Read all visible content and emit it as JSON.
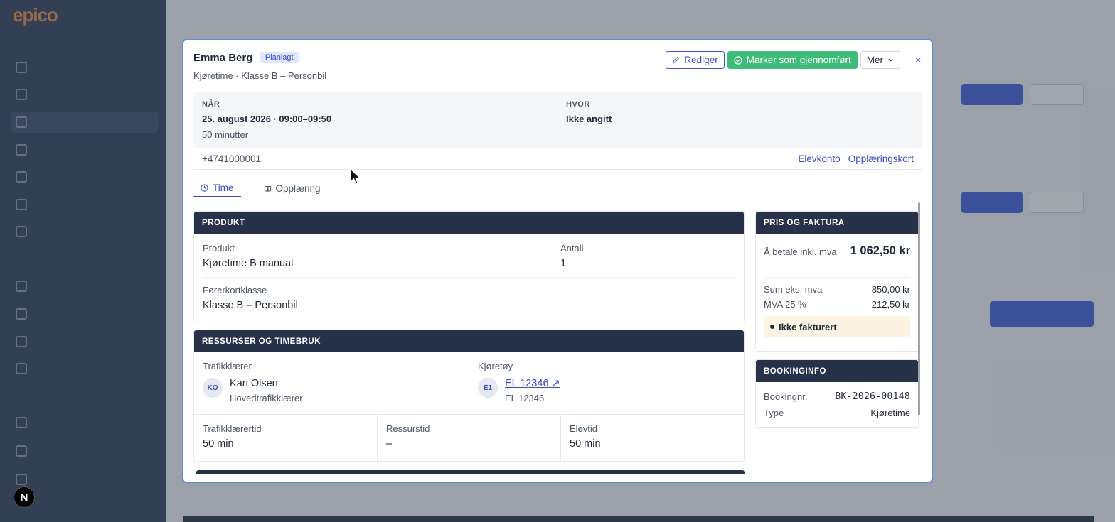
{
  "modal": {
    "student_name": "Emma Berg",
    "status_badge": "Planlagt",
    "subtitle": "Kjøretime · Klasse B – Personbil",
    "edit_label": "Rediger",
    "complete_label": "Marker som gjennomført",
    "more_label": "Mer",
    "close_label": "×"
  },
  "info": {
    "when_label": "NÅR",
    "when_value": "25. august 2026 · 09:00–09:50",
    "duration": "50 minutter",
    "where_label": "HVOR",
    "where_value": "Ikke angitt",
    "phone": "+4741000001",
    "link_account": "Elevkonto",
    "link_training": "Opplæringskort"
  },
  "tabs": [
    {
      "label": "Time",
      "icon": "clock-icon",
      "active": true
    },
    {
      "label": "Opplæring",
      "icon": "book-icon",
      "active": false
    }
  ],
  "product": {
    "header": "PRODUKT",
    "product_label": "Produkt",
    "product_value": "Kjøretime B manual",
    "qty_label": "Antall",
    "qty_value": "1",
    "class_label": "Førerkortklasse",
    "class_value": "Klasse B – Personbil"
  },
  "resources": {
    "header": "RESSURSER OG TIMEBRUK",
    "instructor_label": "Trafikklærer",
    "instructor_initials": "KO",
    "instructor_name": "Kari Olsen",
    "instructor_role": "Hovedtrafikklærer",
    "vehicle_label": "Kjøretøy",
    "vehicle_initials": "E1",
    "vehicle_link": "EL 12346 ↗",
    "vehicle_reg": "EL 12346",
    "instructor_time_label": "Trafikklærertid",
    "instructor_time_value": "50 min",
    "resource_time_label": "Ressurstid",
    "resource_time_value": "–",
    "student_time_label": "Elevtid",
    "student_time_value": "50 min"
  },
  "price": {
    "header": "PRIS OG FAKTURA",
    "total_label": "Å betale inkl. mva",
    "total_value": "1 062,50 kr",
    "sum_label": "Sum eks. mva",
    "sum_value": "850,00 kr",
    "vat_label": "MVA 25 %",
    "vat_value": "212,50 kr",
    "invoice_status": "Ikke fakturert"
  },
  "booking": {
    "header": "BOOKINGINFO",
    "number_label": "Bookingnr.",
    "number_value": "BK-2026-00148",
    "type_label": "Type",
    "type_value": "Kjøretime"
  },
  "background": {
    "launcher_letter": "N"
  },
  "colors": {
    "accent": "#3b4cc0",
    "success": "#3ebd7a",
    "panel_header": "#27324a",
    "sidebar": "#2b3a55"
  }
}
